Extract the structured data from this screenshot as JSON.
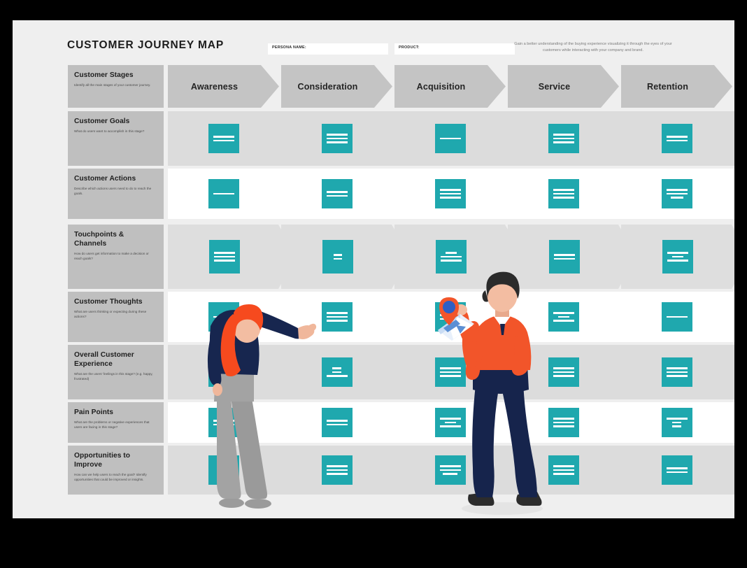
{
  "header": {
    "title": "CUSTOMER JOURNEY MAP",
    "persona_label": "PERSONA NAME:",
    "persona_value": "",
    "product_label": "PRODUCT:",
    "product_value": "",
    "intro": "Gain a better understanding of the buying experience visualizing it through the eyes of your customers while interacting with your company and brand."
  },
  "colors": {
    "teal": "#1fa8ae",
    "label_gray": "#bfbfbf",
    "stage_gray": "#c4c4c4",
    "row_shade": "#dcdcdc",
    "chevron_gray": "#dedede",
    "canvas": "#efefef",
    "frame": "#000000"
  },
  "stages": [
    {
      "name": "Awareness"
    },
    {
      "name": "Consideration"
    },
    {
      "name": "Acquisition"
    },
    {
      "name": "Service"
    },
    {
      "name": "Retention"
    }
  ],
  "rows": [
    {
      "id": "customer-stages",
      "title": "Customer Stages",
      "desc": "Identify all the main stages of your customer journey.",
      "style": "stage-header",
      "band": "none",
      "cells": []
    },
    {
      "id": "customer-goals",
      "title": "Customer Goals",
      "desc": "What do users want to accomplish in this stage?",
      "style": "cards",
      "band": "shaded",
      "cells": [
        {
          "lines": [
            100,
            100
          ]
        },
        {
          "lines": [
            100,
            100,
            100
          ]
        },
        {
          "lines": [
            100
          ]
        },
        {
          "lines": [
            100,
            100,
            100
          ]
        },
        {
          "lines": [
            100,
            100
          ]
        }
      ]
    },
    {
      "id": "customer-actions",
      "title": "Customer Actions",
      "desc": "Describe which actions users need to do to reach the goals.",
      "style": "cards",
      "band": "plain",
      "cells": [
        {
          "lines": [
            100
          ]
        },
        {
          "lines": [
            100,
            100
          ]
        },
        {
          "lines": [
            100,
            100,
            100
          ]
        },
        {
          "lines": [
            100,
            100,
            100
          ]
        },
        {
          "lines": [
            100,
            100,
            60
          ]
        }
      ]
    },
    {
      "id": "touchpoints-channels",
      "title": "Touchpoints & Channels",
      "desc": "How do users get information to make a decision or reach goals?",
      "style": "chevrons",
      "band": "none",
      "cells": [
        {
          "lines": [
            100,
            100,
            100
          ]
        },
        {
          "lines": [
            40,
            40
          ]
        },
        {
          "lines": [
            55,
            100,
            100
          ]
        },
        {
          "lines": [
            100,
            100
          ]
        },
        {
          "lines": [
            100,
            55,
            100
          ]
        }
      ]
    },
    {
      "id": "customer-thoughts",
      "title": "Customer Thoughts",
      "desc": "What are users thinking or expecting during these actions?",
      "style": "cards",
      "band": "plain",
      "cells": [
        {
          "lines": [
            100
          ]
        },
        {
          "lines": [
            100,
            100,
            100
          ]
        },
        {
          "lines": [
            100,
            100
          ]
        },
        {
          "lines": [
            100,
            55,
            100
          ]
        },
        {
          "lines": [
            100
          ]
        }
      ]
    },
    {
      "id": "overall-customer-experience",
      "title": "Overall Customer Experience",
      "desc": "What are the users' feelings in this stage? (e.g. happy, frustrated)",
      "style": "cards",
      "band": "shaded",
      "cells": [
        {
          "lines": [
            100,
            100
          ]
        },
        {
          "lines": [
            45,
            45,
            100
          ]
        },
        {
          "lines": [
            100,
            100,
            100
          ]
        },
        {
          "lines": [
            100,
            100,
            100
          ]
        },
        {
          "lines": [
            100,
            100,
            100
          ]
        }
      ]
    },
    {
      "id": "pain-points",
      "title": "Pain Points",
      "desc": "What are the problems or negative experiences that users are facing in this stage?",
      "style": "cards",
      "band": "plain",
      "cells": [
        {
          "lines": [
            100,
            100
          ]
        },
        {
          "lines": [
            100,
            100
          ]
        },
        {
          "lines": [
            100,
            55,
            100
          ]
        },
        {
          "lines": [
            100,
            100,
            100
          ]
        },
        {
          "lines": [
            100,
            45,
            45
          ]
        }
      ]
    },
    {
      "id": "opportunities-to-improve",
      "title": "Opportunities to Improve",
      "desc": "How can we help users to reach the goal? Identify opportunities that could be improved or insights.",
      "style": "cards",
      "band": "shaded",
      "cells": [
        {
          "lines": [
            45,
            45
          ]
        },
        {
          "lines": [
            100,
            100,
            100
          ]
        },
        {
          "lines": [
            100,
            100,
            70
          ]
        },
        {
          "lines": [
            100,
            100,
            100
          ]
        },
        {
          "lines": [
            100,
            100
          ]
        }
      ]
    }
  ],
  "illustrations": {
    "woman": "woman-pointing-at-board",
    "man": "man-holding-map-with-pin"
  }
}
